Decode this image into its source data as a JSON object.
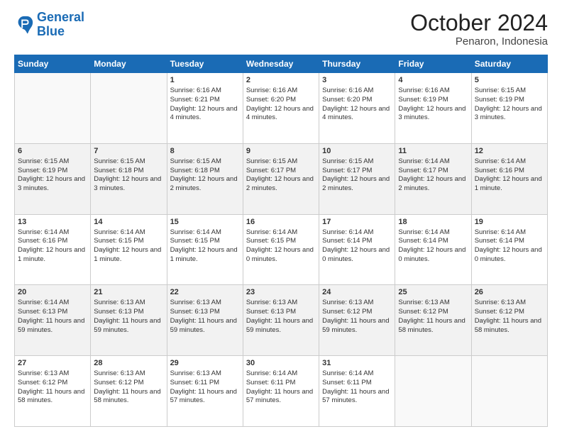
{
  "header": {
    "logo": {
      "line1": "General",
      "line2": "Blue"
    },
    "title": "October 2024",
    "location": "Penaron, Indonesia"
  },
  "days_of_week": [
    "Sunday",
    "Monday",
    "Tuesday",
    "Wednesday",
    "Thursday",
    "Friday",
    "Saturday"
  ],
  "weeks": [
    [
      {
        "day": "",
        "sunrise": "",
        "sunset": "",
        "daylight": ""
      },
      {
        "day": "",
        "sunrise": "",
        "sunset": "",
        "daylight": ""
      },
      {
        "day": "1",
        "sunrise": "Sunrise: 6:16 AM",
        "sunset": "Sunset: 6:21 PM",
        "daylight": "Daylight: 12 hours and 4 minutes."
      },
      {
        "day": "2",
        "sunrise": "Sunrise: 6:16 AM",
        "sunset": "Sunset: 6:20 PM",
        "daylight": "Daylight: 12 hours and 4 minutes."
      },
      {
        "day": "3",
        "sunrise": "Sunrise: 6:16 AM",
        "sunset": "Sunset: 6:20 PM",
        "daylight": "Daylight: 12 hours and 4 minutes."
      },
      {
        "day": "4",
        "sunrise": "Sunrise: 6:16 AM",
        "sunset": "Sunset: 6:19 PM",
        "daylight": "Daylight: 12 hours and 3 minutes."
      },
      {
        "day": "5",
        "sunrise": "Sunrise: 6:15 AM",
        "sunset": "Sunset: 6:19 PM",
        "daylight": "Daylight: 12 hours and 3 minutes."
      }
    ],
    [
      {
        "day": "6",
        "sunrise": "Sunrise: 6:15 AM",
        "sunset": "Sunset: 6:19 PM",
        "daylight": "Daylight: 12 hours and 3 minutes."
      },
      {
        "day": "7",
        "sunrise": "Sunrise: 6:15 AM",
        "sunset": "Sunset: 6:18 PM",
        "daylight": "Daylight: 12 hours and 3 minutes."
      },
      {
        "day": "8",
        "sunrise": "Sunrise: 6:15 AM",
        "sunset": "Sunset: 6:18 PM",
        "daylight": "Daylight: 12 hours and 2 minutes."
      },
      {
        "day": "9",
        "sunrise": "Sunrise: 6:15 AM",
        "sunset": "Sunset: 6:17 PM",
        "daylight": "Daylight: 12 hours and 2 minutes."
      },
      {
        "day": "10",
        "sunrise": "Sunrise: 6:15 AM",
        "sunset": "Sunset: 6:17 PM",
        "daylight": "Daylight: 12 hours and 2 minutes."
      },
      {
        "day": "11",
        "sunrise": "Sunrise: 6:14 AM",
        "sunset": "Sunset: 6:17 PM",
        "daylight": "Daylight: 12 hours and 2 minutes."
      },
      {
        "day": "12",
        "sunrise": "Sunrise: 6:14 AM",
        "sunset": "Sunset: 6:16 PM",
        "daylight": "Daylight: 12 hours and 1 minute."
      }
    ],
    [
      {
        "day": "13",
        "sunrise": "Sunrise: 6:14 AM",
        "sunset": "Sunset: 6:16 PM",
        "daylight": "Daylight: 12 hours and 1 minute."
      },
      {
        "day": "14",
        "sunrise": "Sunrise: 6:14 AM",
        "sunset": "Sunset: 6:15 PM",
        "daylight": "Daylight: 12 hours and 1 minute."
      },
      {
        "day": "15",
        "sunrise": "Sunrise: 6:14 AM",
        "sunset": "Sunset: 6:15 PM",
        "daylight": "Daylight: 12 hours and 1 minute."
      },
      {
        "day": "16",
        "sunrise": "Sunrise: 6:14 AM",
        "sunset": "Sunset: 6:15 PM",
        "daylight": "Daylight: 12 hours and 0 minutes."
      },
      {
        "day": "17",
        "sunrise": "Sunrise: 6:14 AM",
        "sunset": "Sunset: 6:14 PM",
        "daylight": "Daylight: 12 hours and 0 minutes."
      },
      {
        "day": "18",
        "sunrise": "Sunrise: 6:14 AM",
        "sunset": "Sunset: 6:14 PM",
        "daylight": "Daylight: 12 hours and 0 minutes."
      },
      {
        "day": "19",
        "sunrise": "Sunrise: 6:14 AM",
        "sunset": "Sunset: 6:14 PM",
        "daylight": "Daylight: 12 hours and 0 minutes."
      }
    ],
    [
      {
        "day": "20",
        "sunrise": "Sunrise: 6:14 AM",
        "sunset": "Sunset: 6:13 PM",
        "daylight": "Daylight: 11 hours and 59 minutes."
      },
      {
        "day": "21",
        "sunrise": "Sunrise: 6:13 AM",
        "sunset": "Sunset: 6:13 PM",
        "daylight": "Daylight: 11 hours and 59 minutes."
      },
      {
        "day": "22",
        "sunrise": "Sunrise: 6:13 AM",
        "sunset": "Sunset: 6:13 PM",
        "daylight": "Daylight: 11 hours and 59 minutes."
      },
      {
        "day": "23",
        "sunrise": "Sunrise: 6:13 AM",
        "sunset": "Sunset: 6:13 PM",
        "daylight": "Daylight: 11 hours and 59 minutes."
      },
      {
        "day": "24",
        "sunrise": "Sunrise: 6:13 AM",
        "sunset": "Sunset: 6:12 PM",
        "daylight": "Daylight: 11 hours and 59 minutes."
      },
      {
        "day": "25",
        "sunrise": "Sunrise: 6:13 AM",
        "sunset": "Sunset: 6:12 PM",
        "daylight": "Daylight: 11 hours and 58 minutes."
      },
      {
        "day": "26",
        "sunrise": "Sunrise: 6:13 AM",
        "sunset": "Sunset: 6:12 PM",
        "daylight": "Daylight: 11 hours and 58 minutes."
      }
    ],
    [
      {
        "day": "27",
        "sunrise": "Sunrise: 6:13 AM",
        "sunset": "Sunset: 6:12 PM",
        "daylight": "Daylight: 11 hours and 58 minutes."
      },
      {
        "day": "28",
        "sunrise": "Sunrise: 6:13 AM",
        "sunset": "Sunset: 6:12 PM",
        "daylight": "Daylight: 11 hours and 58 minutes."
      },
      {
        "day": "29",
        "sunrise": "Sunrise: 6:13 AM",
        "sunset": "Sunset: 6:11 PM",
        "daylight": "Daylight: 11 hours and 57 minutes."
      },
      {
        "day": "30",
        "sunrise": "Sunrise: 6:14 AM",
        "sunset": "Sunset: 6:11 PM",
        "daylight": "Daylight: 11 hours and 57 minutes."
      },
      {
        "day": "31",
        "sunrise": "Sunrise: 6:14 AM",
        "sunset": "Sunset: 6:11 PM",
        "daylight": "Daylight: 11 hours and 57 minutes."
      },
      {
        "day": "",
        "sunrise": "",
        "sunset": "",
        "daylight": ""
      },
      {
        "day": "",
        "sunrise": "",
        "sunset": "",
        "daylight": ""
      }
    ]
  ]
}
